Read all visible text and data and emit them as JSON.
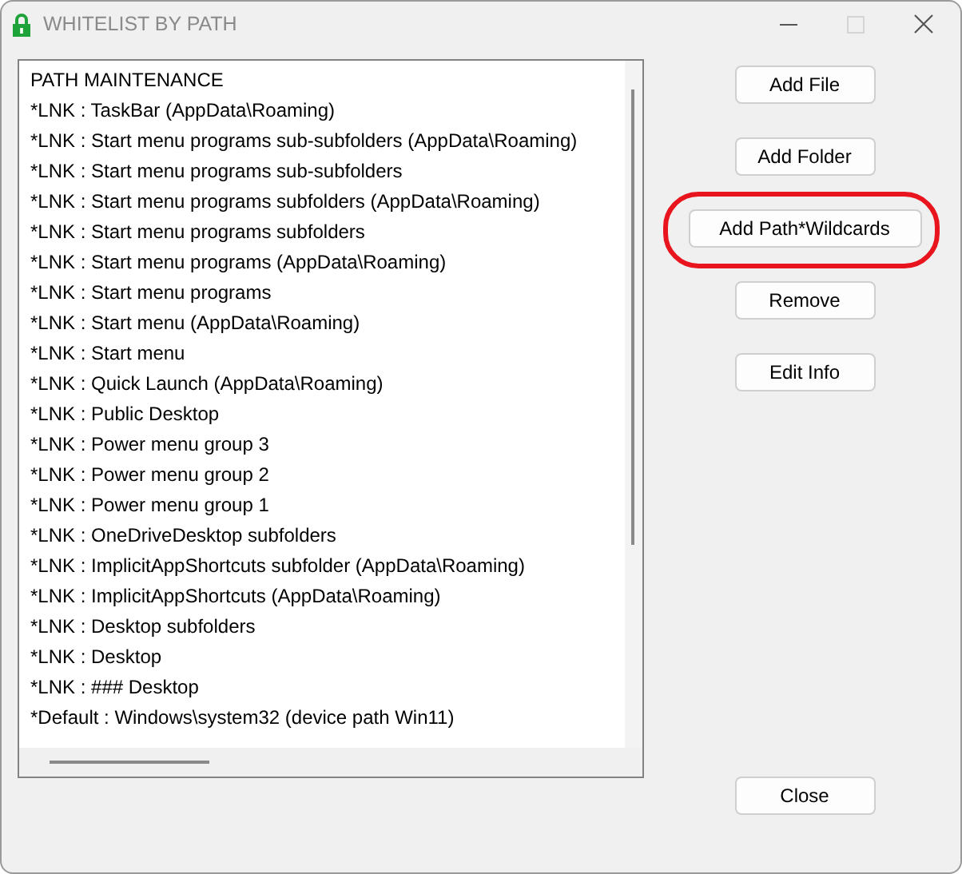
{
  "window": {
    "title": "WHITELIST BY PATH",
    "maximize_disabled": true
  },
  "list": {
    "items": [
      {
        "text": "PATH MAINTENANCE"
      },
      {
        "text": "*LNK : TaskBar (AppData\\Roaming)"
      },
      {
        "text": "*LNK : Start menu programs sub-subfolders (AppData\\Roaming)"
      },
      {
        "text": "*LNK : Start menu programs sub-subfolders"
      },
      {
        "text": "*LNK : Start menu programs subfolders (AppData\\Roaming)"
      },
      {
        "text": "*LNK : Start menu programs subfolders"
      },
      {
        "text": "*LNK : Start menu programs (AppData\\Roaming)"
      },
      {
        "text": "*LNK : Start menu programs"
      },
      {
        "text": "*LNK : Start menu (AppData\\Roaming)"
      },
      {
        "text": "*LNK : Start menu"
      },
      {
        "text": "*LNK : Quick Launch (AppData\\Roaming)"
      },
      {
        "text": "*LNK : Public Desktop"
      },
      {
        "text": "*LNK : Power menu group 3"
      },
      {
        "text": "*LNK : Power menu group 2"
      },
      {
        "text": "*LNK : Power menu group 1"
      },
      {
        "text": "*LNK : OneDriveDesktop subfolders"
      },
      {
        "text": "*LNK : ImplicitAppShortcuts subfolder (AppData\\Roaming)"
      },
      {
        "text": "*LNK : ImplicitAppShortcuts (AppData\\Roaming)"
      },
      {
        "text": "*LNK : Desktop subfolders"
      },
      {
        "text": "*LNK : Desktop"
      },
      {
        "text": "*LNK : ### Desktop"
      },
      {
        "text": "*Default : Windows\\system32  (device path Win11)"
      }
    ]
  },
  "buttons": [
    {
      "label": "Add File",
      "wide": false,
      "highlighted": false
    },
    {
      "label": "Add Folder",
      "wide": false,
      "highlighted": false
    },
    {
      "label": "Add Path*Wildcards",
      "wide": true,
      "highlighted": true
    },
    {
      "label": "Remove",
      "wide": false,
      "highlighted": false
    },
    {
      "label": "Edit Info",
      "wide": false,
      "highlighted": false
    }
  ],
  "close_button": {
    "label": "Close"
  }
}
